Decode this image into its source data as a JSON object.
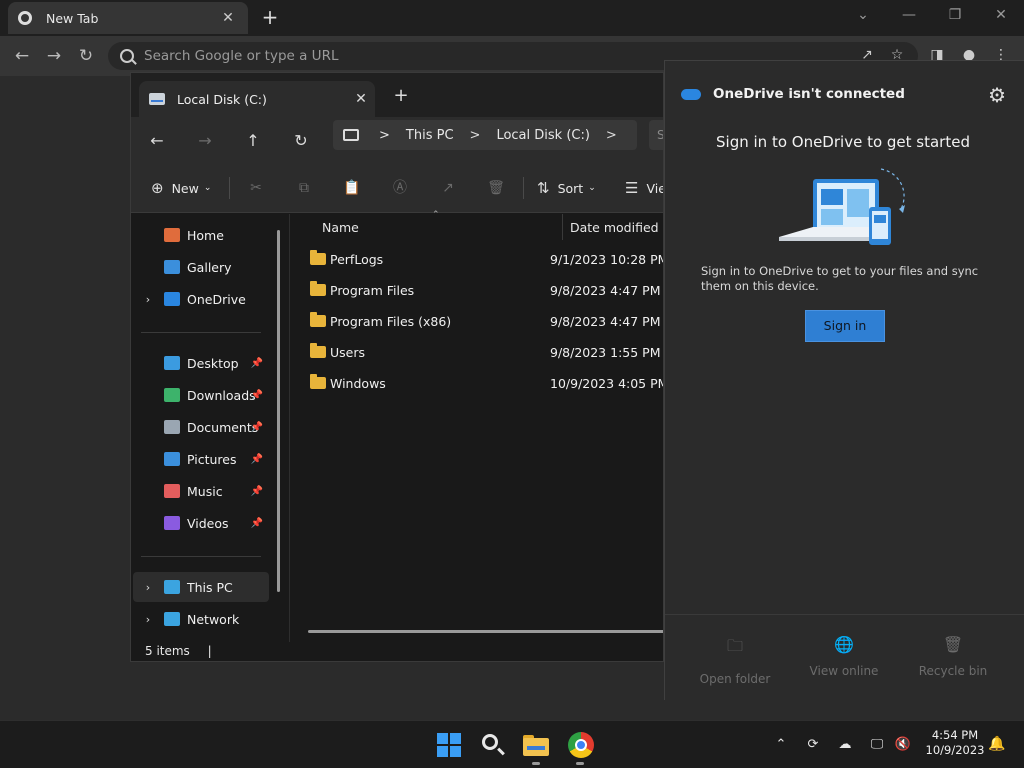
{
  "chrome": {
    "tab_title": "New Tab",
    "omnibox_placeholder": "Search Google or type a URL",
    "back_icon": "←",
    "forward_icon": "→",
    "reload_icon": "↻",
    "newtab_icon": "+",
    "close_tab_icon": "✕",
    "minimize_icon": "—",
    "restore_icon": "❐",
    "close_icon": "✕",
    "collapse_icon": "⌄",
    "share_icon": "↗",
    "star_icon": "☆",
    "sidepanel_icon": "◨",
    "profile_icon": "●",
    "menu_icon": "⋮"
  },
  "explorer": {
    "tab_title": "Local Disk (C:)",
    "close_tab_icon": "✕",
    "newtab_icon": "+",
    "breadcrumb": [
      "This PC",
      "Local Disk (C:)"
    ],
    "breadcrumb_sep": ">",
    "search_stub": "S",
    "commands": {
      "new_label": "New",
      "sort_label": "Sort",
      "view_label": "Vie"
    },
    "nav_pane": {
      "group1": [
        {
          "label": "Home",
          "icon": "home-icon",
          "color": "#e06c3c",
          "chevron": false
        },
        {
          "label": "Gallery",
          "icon": "gallery-icon",
          "color": "#3b8fdc",
          "chevron": false
        },
        {
          "label": "OneDrive",
          "icon": "onedrive-icon",
          "color": "#2a86e0",
          "chevron": true
        }
      ],
      "quick_access": [
        {
          "label": "Desktop",
          "icon": "desktop-icon",
          "color": "#3b9be0"
        },
        {
          "label": "Downloads",
          "icon": "downloads-icon",
          "color": "#3db36b"
        },
        {
          "label": "Documents",
          "icon": "documents-icon",
          "color": "#9aa6b2"
        },
        {
          "label": "Pictures",
          "icon": "pictures-icon",
          "color": "#3b8fdc"
        },
        {
          "label": "Music",
          "icon": "music-icon",
          "color": "#e35d5d"
        },
        {
          "label": "Videos",
          "icon": "videos-icon",
          "color": "#8a5be0"
        }
      ],
      "group3": [
        {
          "label": "This PC",
          "icon": "this-pc-icon",
          "color": "#3ba4e0",
          "chevron": true
        },
        {
          "label": "Network",
          "icon": "network-icon",
          "color": "#3ba4e0",
          "chevron": true
        }
      ]
    },
    "columns": {
      "name": "Name",
      "date": "Date modified"
    },
    "files": [
      {
        "name": "PerfLogs",
        "date": "9/1/2023 10:28 PM"
      },
      {
        "name": "Program Files",
        "date": "9/8/2023 4:47 PM"
      },
      {
        "name": "Program Files (x86)",
        "date": "9/8/2023 4:47 PM"
      },
      {
        "name": "Users",
        "date": "9/8/2023 1:55 PM"
      },
      {
        "name": "Windows",
        "date": "10/9/2023 4:05 PM"
      }
    ],
    "status": "5 items",
    "status_cursor": "|"
  },
  "onedrive": {
    "title": "OneDrive isn't connected",
    "heading": "Sign in to OneDrive to get started",
    "description": "Sign in to OneDrive to get to your files and sync them on this device.",
    "signin_label": "Sign in",
    "gear_icon": "⚙",
    "footer": [
      {
        "label": "Open folder",
        "icon": "🗀"
      },
      {
        "label": "View online",
        "icon": "🌐"
      },
      {
        "label": "Recycle bin",
        "icon": "🗑"
      }
    ]
  },
  "taskbar": {
    "time": "4:54 PM",
    "date": "10/9/2023",
    "tray_chevron": "⌃",
    "bell_icon": "🔔"
  }
}
